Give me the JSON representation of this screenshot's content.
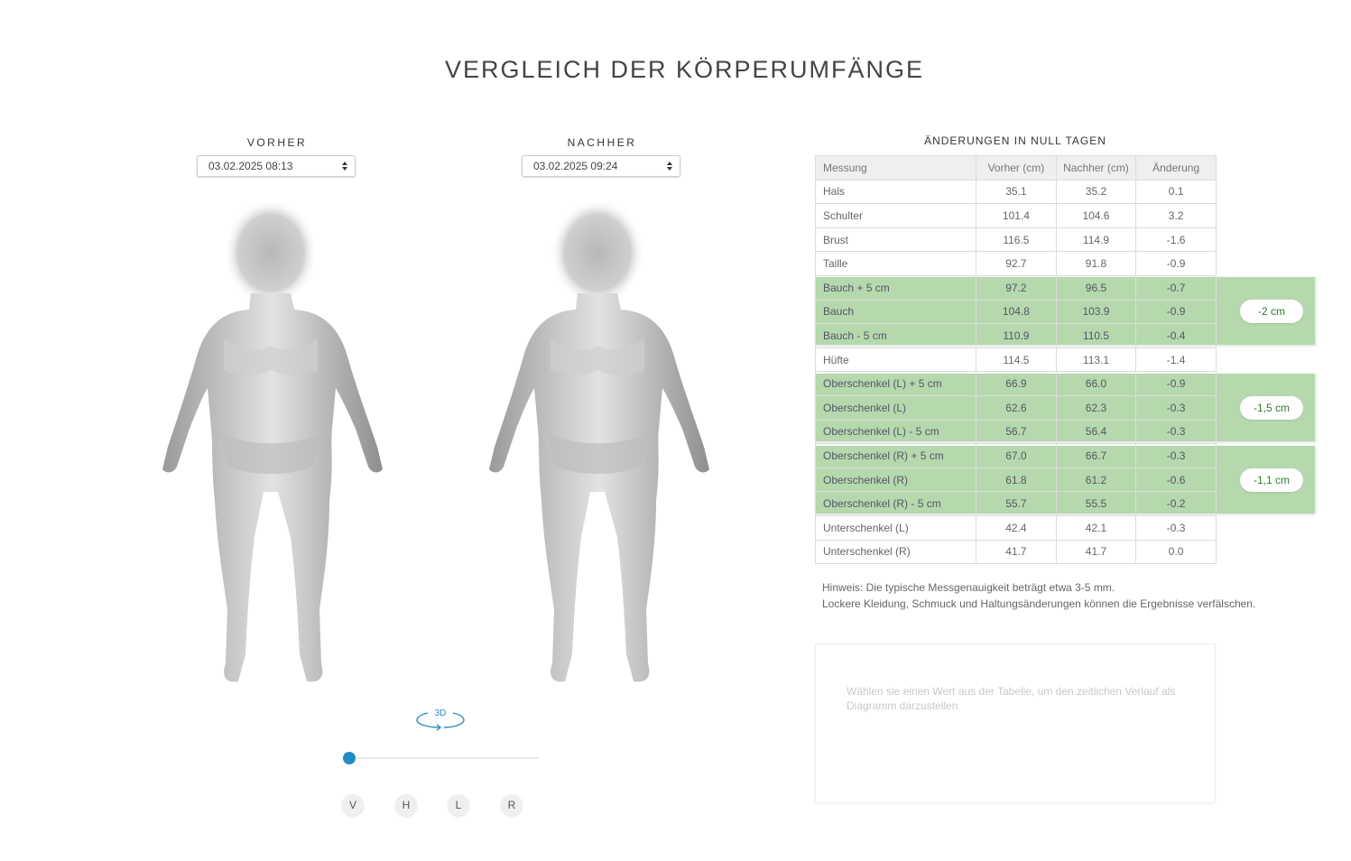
{
  "page": {
    "title": "VERGLEICH DER KÖRPERUMFÄNGE"
  },
  "before": {
    "label": "VORHER",
    "selected": "03.02.2025 08:13"
  },
  "after": {
    "label": "NACHHER",
    "selected": "03.02.2025 09:24"
  },
  "viewer": {
    "rotate_label": "3D",
    "slider_value": 0,
    "views": [
      "V",
      "H",
      "L",
      "R"
    ]
  },
  "table": {
    "title": "ÄNDERUNGEN IN NULL TAGEN",
    "headers": [
      "Messung",
      "Vorher (cm)",
      "Nachher (cm)",
      "Änderung"
    ],
    "rows": [
      [
        "Hals",
        "35.1",
        "35.2",
        "0.1"
      ],
      [
        "Schulter",
        "101.4",
        "104.6",
        "3.2"
      ],
      [
        "Brust",
        "116.5",
        "114.9",
        "-1.6"
      ],
      [
        "Taille",
        "92.7",
        "91.8",
        "-0.9"
      ],
      [
        "Bauch + 5 cm",
        "97.2",
        "96.5",
        "-0.7"
      ],
      [
        "Bauch",
        "104.8",
        "103.9",
        "-0.9"
      ],
      [
        "Bauch - 5 cm",
        "110.9",
        "110.5",
        "-0.4"
      ],
      [
        "Hüfte",
        "114.5",
        "113.1",
        "-1.4"
      ],
      [
        "Oberschenkel (L) + 5 cm",
        "66.9",
        "66.0",
        "-0.9"
      ],
      [
        "Oberschenkel (L)",
        "62.6",
        "62.3",
        "-0.3"
      ],
      [
        "Oberschenkel (L) - 5 cm",
        "56.7",
        "56.4",
        "-0.3"
      ],
      [
        "Oberschenkel (R) + 5 cm",
        "67.0",
        "66.7",
        "-0.3"
      ],
      [
        "Oberschenkel (R)",
        "61.8",
        "61.2",
        "-0.6"
      ],
      [
        "Oberschenkel (R) - 5 cm",
        "55.7",
        "55.5",
        "-0.2"
      ],
      [
        "Unterschenkel (L)",
        "42.4",
        "42.1",
        "-0.3"
      ],
      [
        "Unterschenkel (R)",
        "41.7",
        "41.7",
        "0.0"
      ]
    ],
    "groups": [
      {
        "badge": "-2 cm"
      },
      {
        "badge": "-1,5 cm"
      },
      {
        "badge": "-1,1 cm"
      }
    ],
    "highlight_color": "#b5d9ad"
  },
  "note": {
    "line1": "Hinweis: Die typische Messgenauigkeit beträgt etwa 3-5 mm.",
    "line2": "Lockere Kleidung, Schmuck und Haltungsänderungen können die Ergebnisse verfälschen."
  },
  "chart_placeholder": "Wählen sie einen Wert aus der Tabelle, um den zeitlichen Verlauf als Diagramm darzustellen",
  "colors": {
    "accent": "#1f8dbf",
    "badge_text": "#2d7a2d"
  }
}
